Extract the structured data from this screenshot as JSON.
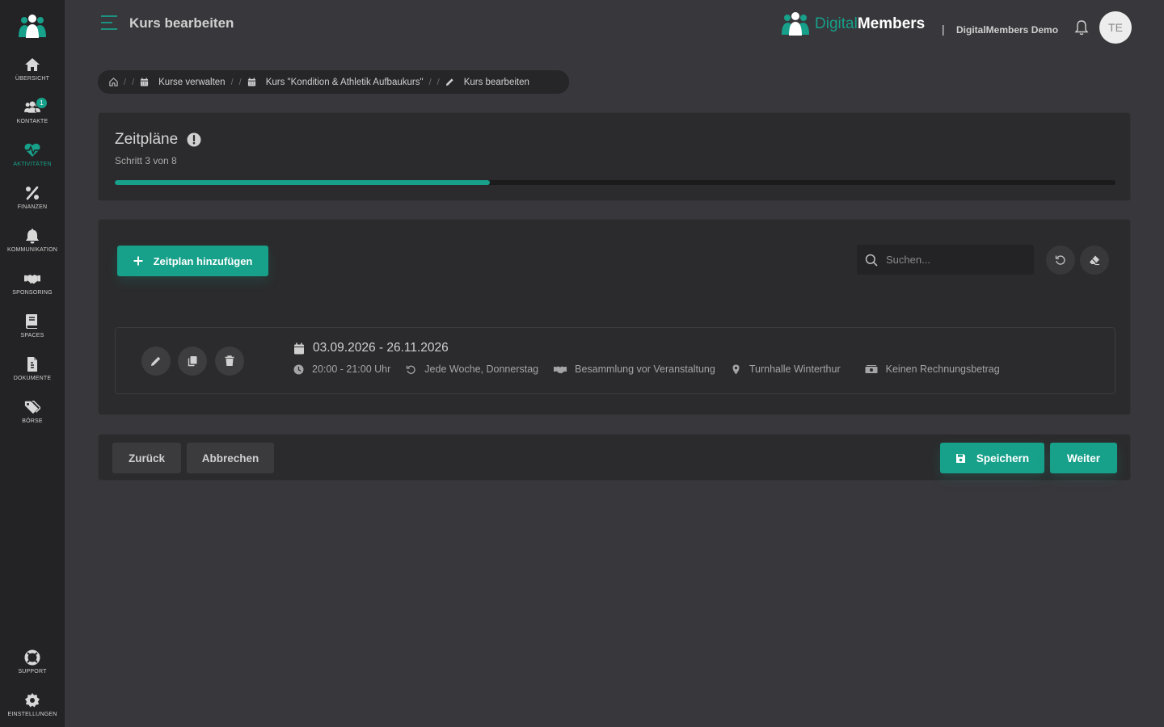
{
  "colors": {
    "accent": "#17a08a",
    "sidebar": "#232325",
    "background": "#38373b",
    "card": "#2b2b2d"
  },
  "sidebar": {
    "items": [
      {
        "label": "Übersicht",
        "icon": "home-icon"
      },
      {
        "label": "Kontakte",
        "icon": "users-icon",
        "badge": "1"
      },
      {
        "label": "Aktivitäten",
        "icon": "heartbeat-icon",
        "active": true
      },
      {
        "label": "Finanzen",
        "icon": "percent-icon"
      },
      {
        "label": "Kommunikation",
        "icon": "bell-icon"
      },
      {
        "label": "Sponsoring",
        "icon": "handshake-icon"
      },
      {
        "label": "Spaces",
        "icon": "book-icon"
      },
      {
        "label": "Dokumente",
        "icon": "file-icon"
      },
      {
        "label": "Börse",
        "icon": "tags-icon"
      }
    ],
    "bottom": [
      {
        "label": "Support",
        "icon": "life-ring-icon"
      },
      {
        "label": "Einstellungen",
        "icon": "gear-icon"
      }
    ]
  },
  "header": {
    "title": "Kurs bearbeiten",
    "brand_light": "Digital",
    "brand_bold": "Members",
    "separator": "|",
    "org": "DigitalMembers Demo",
    "avatar_initials": "TE"
  },
  "breadcrumb": {
    "sep": "/",
    "items": [
      {
        "label": "Kurse verwalten",
        "icon": "calendar-icon"
      },
      {
        "label": "Kurs \"Kondition & Athletik Aufbaukurs\"",
        "icon": "calendar-icon"
      },
      {
        "label": "Kurs bearbeiten",
        "icon": "pencil-icon"
      }
    ]
  },
  "wizard": {
    "title": "Zeitpläne",
    "step_text": "Schritt 3 von 8",
    "progress_percent": 37.5
  },
  "schedules": {
    "add_label": "Zeitplan hinzufügen",
    "search_placeholder": "Suchen...",
    "items": [
      {
        "date_range": "03.09.2026 - 26.11.2026",
        "time": "20:00 - 21:00 Uhr",
        "recurrence": "Jede Woche, Donnerstag",
        "meeting": "Besammlung vor Veranstaltung",
        "location": "Turnhalle Winterthur",
        "billing": "Keinen Rechnungsbetrag"
      }
    ]
  },
  "footer": {
    "back_label": "Zurück",
    "cancel_label": "Abbrechen",
    "save_label": "Speichern",
    "next_label": "Weiter"
  }
}
